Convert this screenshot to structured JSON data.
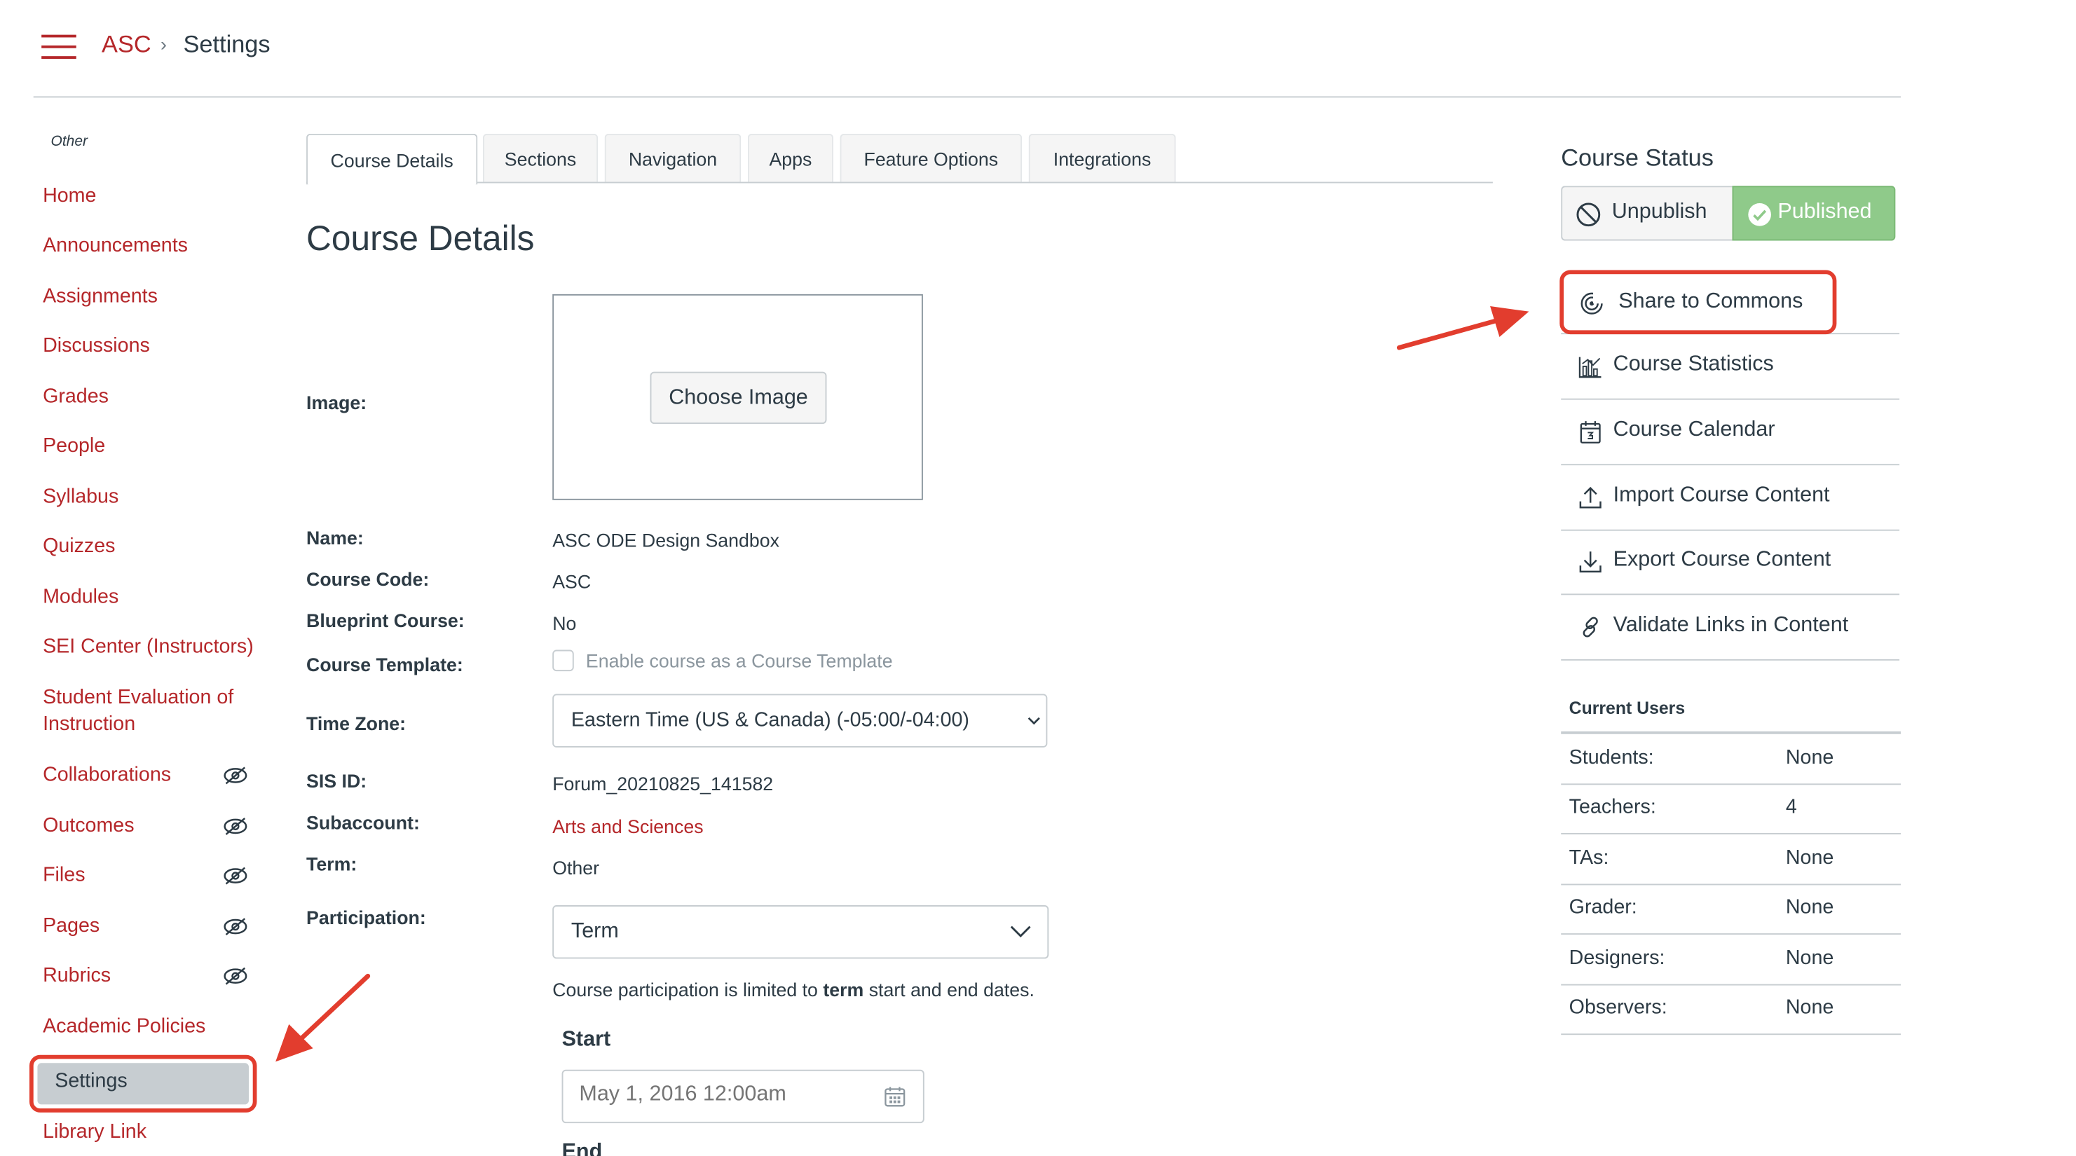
{
  "colors": {
    "accent": "#b5272a",
    "highlight": "#e23d2e",
    "published_green": "#8fca8a"
  },
  "breadcrumb": {
    "root": "ASC",
    "separator": "›",
    "current": "Settings"
  },
  "nav": {
    "section_label": "Other",
    "items": [
      "Home",
      "Announcements",
      "Assignments",
      "Discussions",
      "Grades",
      "People",
      "Syllabus",
      "Quizzes",
      "Modules",
      "SEI Center (Instructors)",
      "Student Evaluation of Instruction",
      "Collaborations",
      "Outcomes",
      "Files",
      "Pages",
      "Rubrics",
      "Academic Policies",
      "Settings",
      "Library Link"
    ],
    "hidden_icon": "eye-slash-icon"
  },
  "tabs": [
    "Course Details",
    "Sections",
    "Navigation",
    "Apps",
    "Feature Options",
    "Integrations"
  ],
  "details": {
    "title": "Course Details",
    "image_label": "Image:",
    "choose_image": "Choose Image",
    "name_label": "Name:",
    "name_value": "ASC ODE Design Sandbox",
    "code_label": "Course Code:",
    "code_value": "ASC",
    "blueprint_label": "Blueprint Course:",
    "blueprint_value": "No",
    "template_label": "Course Template:",
    "template_checkbox": "Enable course as a Course Template",
    "timezone_label": "Time Zone:",
    "timezone_value": "Eastern Time (US & Canada) (-05:00/-04:00)",
    "sis_label": "SIS ID:",
    "sis_value": "Forum_20210825_141582",
    "subaccount_label": "Subaccount:",
    "subaccount_value": "Arts and Sciences",
    "term_label": "Term:",
    "term_value": "Other",
    "participation_label": "Participation:",
    "participation_value": "Term",
    "participation_note_pre": "Course participation is limited to ",
    "participation_note_bold": "term",
    "participation_note_post": " start and end dates.",
    "start_label": "Start",
    "start_value": "May 1, 2016 12:00am",
    "end_label": "End"
  },
  "status": {
    "title": "Course Status",
    "unpublish": "Unpublish",
    "published": "Published"
  },
  "actions": {
    "share": "Share to Commons",
    "statistics": "Course Statistics",
    "calendar": "Course Calendar",
    "import": "Import Course Content",
    "export": "Export Course Content",
    "validate": "Validate Links in Content"
  },
  "users": {
    "title": "Current Users",
    "rows": [
      {
        "label": "Students:",
        "value": "None"
      },
      {
        "label": "Teachers:",
        "value": "4"
      },
      {
        "label": "TAs:",
        "value": "None"
      },
      {
        "label": "Grader:",
        "value": "None"
      },
      {
        "label": "Designers:",
        "value": "None"
      },
      {
        "label": "Observers:",
        "value": "None"
      }
    ]
  }
}
